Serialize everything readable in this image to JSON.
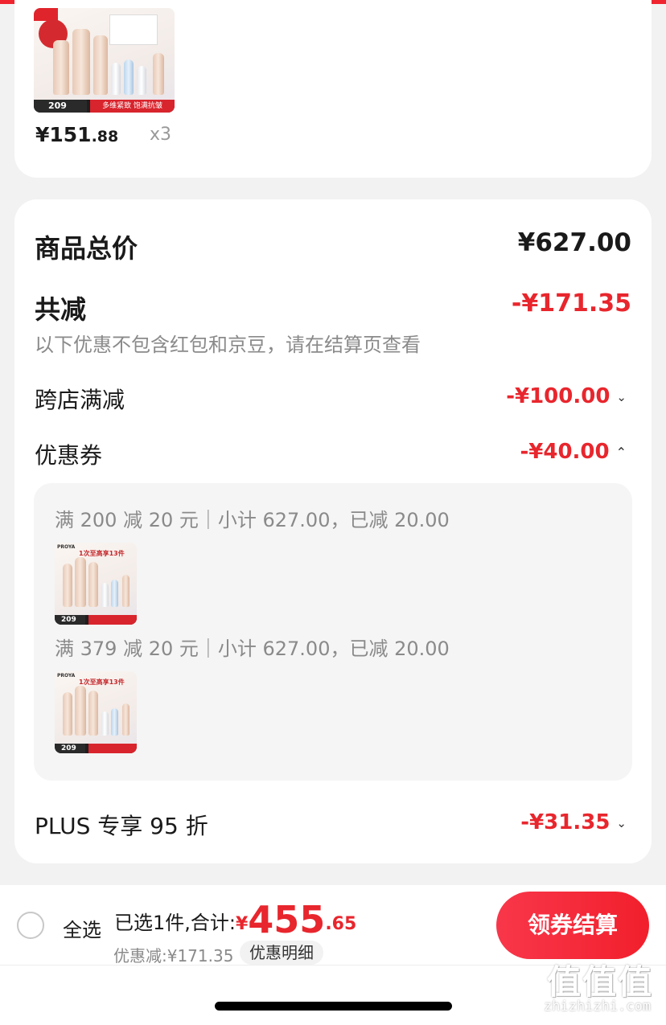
{
  "product": {
    "price_int": "¥151",
    "price_dec": ".88",
    "quantity": "x3",
    "thumb_price": "209",
    "thumb_slogan": "多维紧致 饱满抗皱"
  },
  "summary_card": {
    "total_label": "商品总价",
    "total_value": "¥627.00",
    "reduce_label": "共减",
    "reduce_value": "-¥171.35",
    "note": "以下优惠不包含红包和京豆，请在结算页查看",
    "cross_store_label": "跨店满减",
    "cross_store_value": "-¥100.00",
    "coupon_label": "优惠券",
    "coupon_value": "-¥40.00",
    "coupons": [
      {
        "text": "满 200 减 20 元｜小计 627.00，已减 20.00",
        "thumb_price": "209",
        "thumb_brand": "PROYA",
        "thumb_headline": "1次至高享13件"
      },
      {
        "text": "满 379 减 20 元｜小计 627.00，已减 20.00",
        "thumb_price": "209",
        "thumb_brand": "PROYA",
        "thumb_headline": "1次至高享13件"
      }
    ],
    "plus_label": "PLUS 专享 95 折",
    "plus_value": "-¥31.35"
  },
  "bottom_bar": {
    "select_all": "全选",
    "selected_text": "已选1件,合计:",
    "currency": "¥",
    "total_int": "455",
    "total_dec": ".65",
    "discount_note": "优惠减:¥171.35",
    "detail_button": "优惠明细",
    "checkout_button": "领券结算"
  },
  "watermark": {
    "glyphs": "值值值",
    "site": "zhizhizhi.com"
  },
  "icons": {
    "chevron_down": "chevron-down-icon",
    "chevron_up": "chevron-up-icon",
    "radio": "radio-unchecked-icon"
  },
  "colors": {
    "accent_red": "#e8262d",
    "background": "#f2f2f2",
    "card": "#ffffff"
  }
}
